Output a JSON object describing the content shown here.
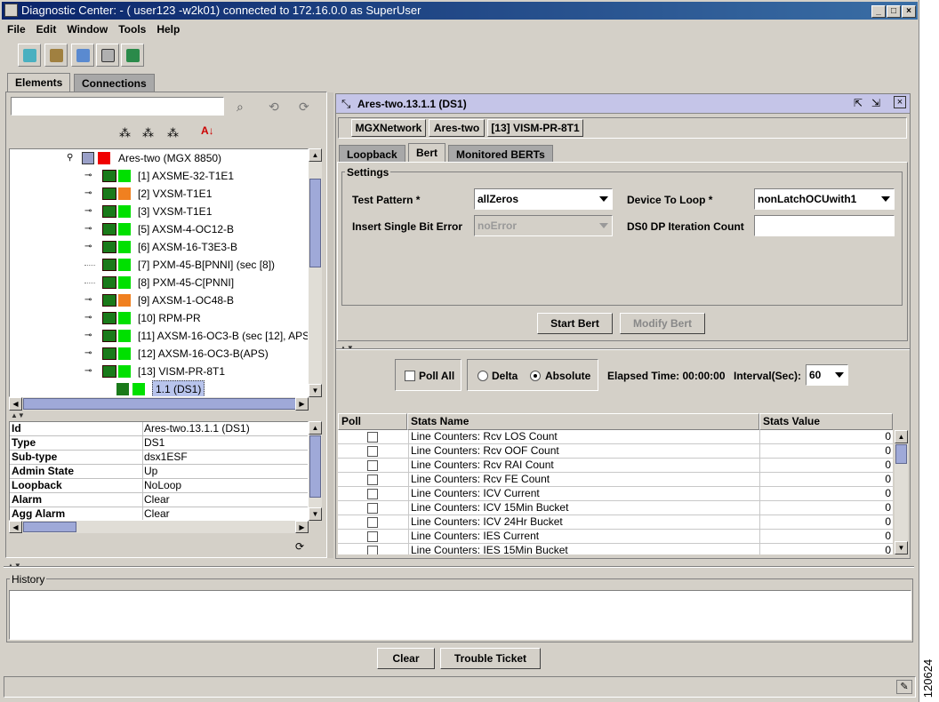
{
  "window": {
    "title": "Diagnostic Center: - ( user123 -w2k01) connected to   172.16.0.0    as SuperUser"
  },
  "menu": [
    "File",
    "Edit",
    "Window",
    "Tools",
    "Help"
  ],
  "main_tabs": [
    "Elements",
    "Connections"
  ],
  "tree": {
    "root": "Ares-two (MGX 8850)",
    "items": [
      {
        "label": "[1] AXSME-32-T1E1",
        "status": "#00e000"
      },
      {
        "label": "[2] VXSM-T1E1",
        "status": "#f08020"
      },
      {
        "label": "[3] VXSM-T1E1",
        "status": "#00e000"
      },
      {
        "label": "[5] AXSM-4-OC12-B",
        "status": "#00e000"
      },
      {
        "label": "[6] AXSM-16-T3E3-B",
        "status": "#00e000"
      },
      {
        "label": "[7] PXM-45-B[PNNI] (sec [8])",
        "status": "#00e000"
      },
      {
        "label": "[8] PXM-45-C[PNNI]",
        "status": "#00e000"
      },
      {
        "label": "[9] AXSM-1-OC48-B",
        "status": "#f08020"
      },
      {
        "label": "[10] RPM-PR",
        "status": "#00e000"
      },
      {
        "label": "[11] AXSM-16-OC3-B (sec [12], APS)",
        "status": "#00e000"
      },
      {
        "label": "[12] AXSM-16-OC3-B(APS)",
        "status": "#00e000"
      },
      {
        "label": "[13] VISM-PR-8T1",
        "status": "#00e000"
      }
    ],
    "selected": "1.1  (DS1)"
  },
  "properties": [
    {
      "k": "Id",
      "v": "Ares-two.13.1.1  (DS1)"
    },
    {
      "k": "Type",
      "v": "DS1"
    },
    {
      "k": "Sub-type",
      "v": "dsx1ESF"
    },
    {
      "k": "Admin State",
      "v": "Up"
    },
    {
      "k": "Loopback",
      "v": "NoLoop"
    },
    {
      "k": "Alarm",
      "v": "Clear"
    },
    {
      "k": "Agg Alarm",
      "v": "Clear"
    }
  ],
  "detail": {
    "title": "Ares-two.13.1.1  (DS1)",
    "breadcrumb": [
      "MGXNetwork",
      "Ares-two",
      "[13] VISM-PR-8T1"
    ],
    "tabs": [
      "Loopback",
      "Bert",
      "Monitored BERTs"
    ],
    "settings_label": "Settings",
    "test_pattern_label": "Test Pattern *",
    "test_pattern_value": "allZeros",
    "device_to_loop_label": "Device To Loop *",
    "device_to_loop_value": "nonLatchOCUwith1",
    "insert_error_label": "Insert Single Bit Error",
    "insert_error_value": "noError",
    "ds0_label": "DS0 DP Iteration Count",
    "ds0_value": "",
    "start_bert": "Start Bert",
    "modify_bert": "Modify Bert"
  },
  "poll": {
    "poll_all": "Poll All",
    "delta": "Delta",
    "absolute": "Absolute",
    "elapsed": "Elapsed Time: 00:00:00",
    "interval_label": "Interval(Sec):",
    "interval_value": "60"
  },
  "stats": {
    "headers": [
      "Poll",
      "Stats Name",
      "Stats Value"
    ],
    "rows": [
      {
        "name": "Line Counters: Rcv LOS Count",
        "value": "0"
      },
      {
        "name": "Line Counters: Rcv OOF Count",
        "value": "0"
      },
      {
        "name": "Line Counters: Rcv RAI Count",
        "value": "0"
      },
      {
        "name": "Line Counters: Rcv FE Count",
        "value": "0"
      },
      {
        "name": "Line Counters: ICV Current",
        "value": "0"
      },
      {
        "name": "Line Counters: ICV 15Min Bucket",
        "value": "0"
      },
      {
        "name": "Line Counters: ICV 24Hr Bucket",
        "value": "0"
      },
      {
        "name": "Line Counters: IES Current",
        "value": "0"
      },
      {
        "name": "Line Counters: IES 15Min Bucket",
        "value": "0"
      }
    ]
  },
  "history": {
    "label": "History",
    "clear": "Clear",
    "trouble_ticket": "Trouble Ticket"
  },
  "figure_number": "120624"
}
